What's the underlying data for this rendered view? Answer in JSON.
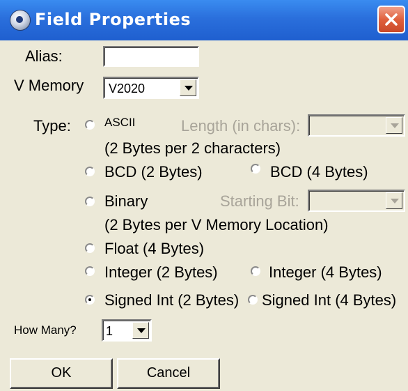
{
  "window": {
    "title": "Field Properties",
    "icon": "app-icon",
    "close_icon": "close-icon"
  },
  "alias": {
    "label": "Alias:",
    "value": ""
  },
  "vmemory": {
    "label": "V Memory",
    "value": "V2020"
  },
  "type": {
    "label": "Type:",
    "options": {
      "ascii": "ASCII",
      "ascii_note": "(2 Bytes per 2 characters)",
      "bcd2": "BCD (2 Bytes)",
      "bcd4": "BCD (4 Bytes)",
      "binary": "Binary",
      "binary_note": "(2 Bytes per V Memory Location)",
      "float4": "Float (4 Bytes)",
      "int2": "Integer (2 Bytes)",
      "int4": "Integer (4 Bytes)",
      "sint2": "Signed Int (2 Bytes)",
      "sint4": "Signed Int (4 Bytes)"
    },
    "selected": "sint2"
  },
  "length": {
    "label": "Length (in chars):",
    "value": ""
  },
  "starting_bit": {
    "label": "Starting Bit:",
    "value": ""
  },
  "how_many": {
    "label": "How Many?",
    "value": "1"
  },
  "buttons": {
    "ok": "OK",
    "cancel": "Cancel"
  }
}
